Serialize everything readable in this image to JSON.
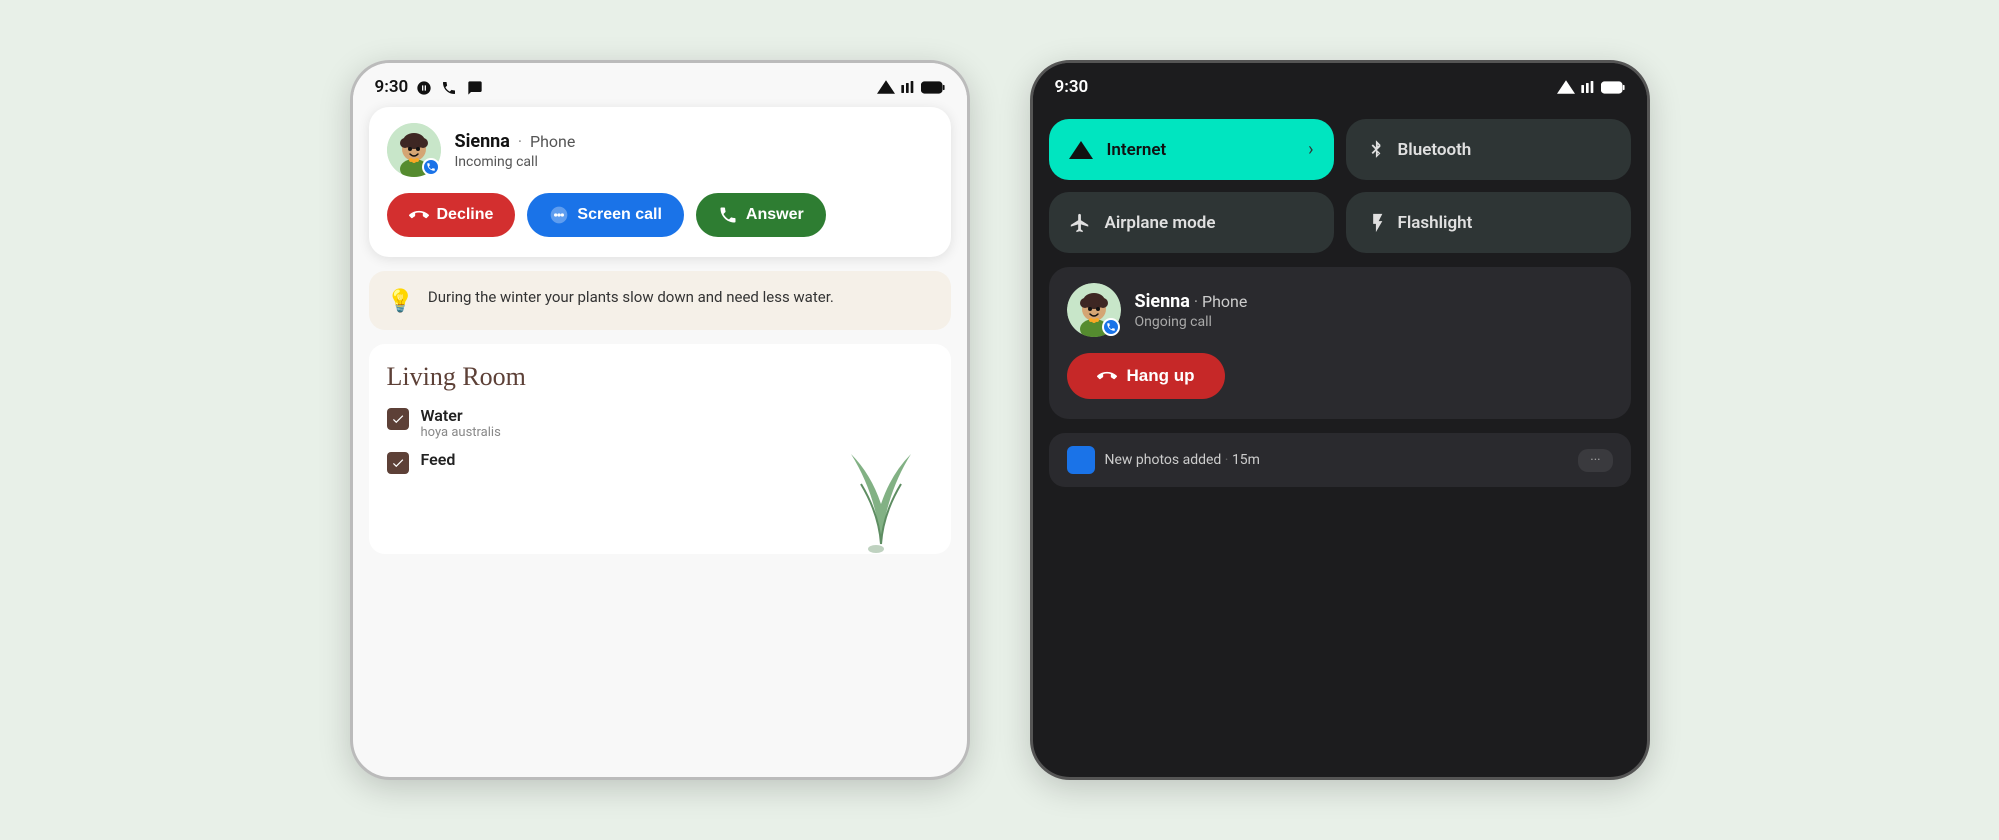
{
  "page": {
    "background_color": "#e8f0e8"
  },
  "phone_light": {
    "status_bar": {
      "time": "9:30",
      "left_icons": [
        "nfc-icon",
        "wifi-calling-icon",
        "message-icon"
      ],
      "right_icons": [
        "wifi-icon",
        "signal-icon",
        "battery-icon"
      ]
    },
    "call_notification": {
      "caller_name": "Sienna",
      "dot": "·",
      "app": "Phone",
      "status": "Incoming call",
      "avatar_emoji": "👩‍🦱",
      "buttons": {
        "decline": "Decline",
        "screen": "Screen call",
        "answer": "Answer"
      }
    },
    "tip_card": {
      "text": "During the winter your plants slow down and need less water."
    },
    "living_room": {
      "title": "Living Room",
      "items": [
        {
          "name": "Water",
          "sub": "hoya australis",
          "checked": true
        },
        {
          "name": "Feed",
          "sub": "",
          "checked": true
        }
      ]
    }
  },
  "phone_dark": {
    "status_bar": {
      "time": "9:30",
      "right_icons": [
        "wifi-icon",
        "signal-icon",
        "battery-icon"
      ]
    },
    "quick_settings": {
      "tiles": [
        {
          "id": "internet",
          "label": "Internet",
          "icon": "wifi",
          "active": true,
          "has_chevron": true
        },
        {
          "id": "bluetooth",
          "label": "Bluetooth",
          "icon": "bluetooth",
          "active": false,
          "has_chevron": false
        },
        {
          "id": "airplane",
          "label": "Airplane mode",
          "icon": "airplane",
          "active": false,
          "has_chevron": false
        },
        {
          "id": "flashlight",
          "label": "Flashlight",
          "icon": "flashlight",
          "active": false,
          "has_chevron": false
        }
      ]
    },
    "call_notification": {
      "caller_name": "Sienna",
      "dot": "·",
      "app": "Phone",
      "status": "Ongoing call",
      "hang_up_label": "Hang up"
    },
    "bottom_notification": {
      "text": "New photos added",
      "time": "15m"
    }
  }
}
